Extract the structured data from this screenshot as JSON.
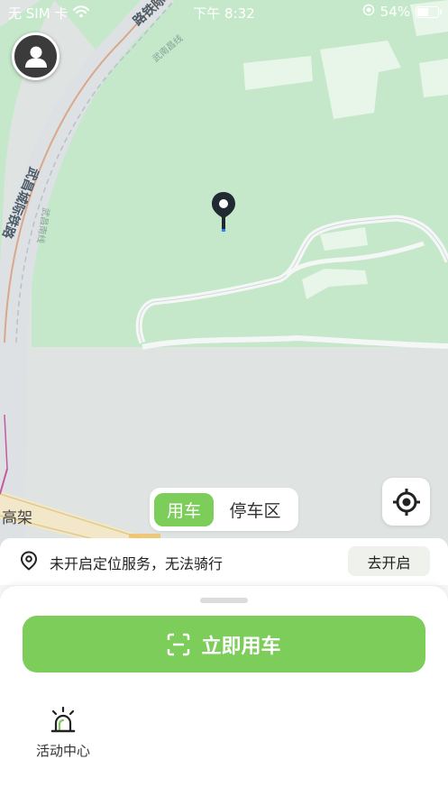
{
  "status_bar": {
    "carrier": "无 SIM 卡",
    "time": "下午 8:32",
    "battery_percent": "54%",
    "battery_level": 0.54
  },
  "map": {
    "labels": {
      "railway_top": "路铁际城",
      "road_top": "武南昌线",
      "railway_left": "武昌城际铁路",
      "road_left": "武昌南线",
      "elevated": "高架"
    }
  },
  "mode_tabs": {
    "active": "用车",
    "inactive": "停车区"
  },
  "location_banner": {
    "message": "未开启定位服务，无法骑行",
    "action": "去开启"
  },
  "bottom_sheet": {
    "ride_button": "立即用车",
    "activity_center": "活动中心"
  },
  "colors": {
    "accent_green": "#7dcd5a",
    "map_green": "#c4e8c9",
    "map_grey": "#dfe3e1"
  },
  "icons": [
    "avatar-icon",
    "map-pin-icon",
    "locate-icon",
    "location-pin-icon",
    "scan-icon",
    "alarm-light-icon",
    "wifi-icon",
    "location-status-icon",
    "battery-icon"
  ]
}
